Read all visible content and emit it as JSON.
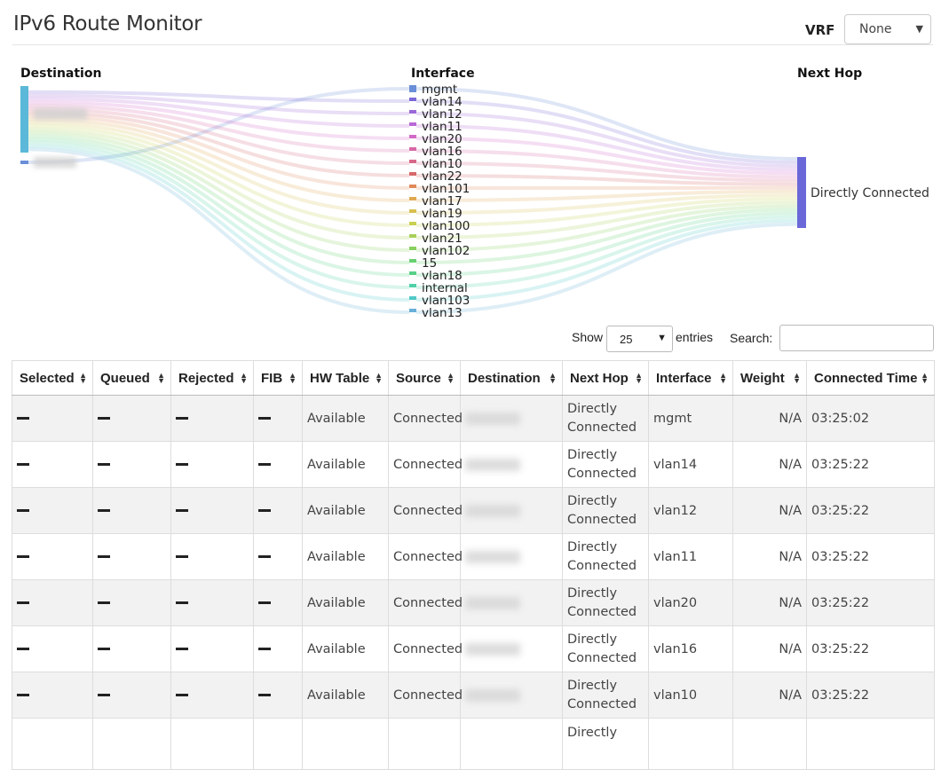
{
  "header": {
    "title": "IPv6 Route Monitor",
    "vrf_label": "VRF",
    "vrf_value": "None"
  },
  "sankey": {
    "headers": {
      "destination": "Destination",
      "interface": "Interface",
      "next_hop": "Next Hop"
    },
    "next_hop_label": "Directly Connected",
    "interfaces": [
      {
        "name": "mgmt",
        "color": "#6a8fd8"
      },
      {
        "name": "vlan14",
        "color": "#7b68d8"
      },
      {
        "name": "vlan12",
        "color": "#9b68d8"
      },
      {
        "name": "vlan11",
        "color": "#b868d8"
      },
      {
        "name": "vlan20",
        "color": "#d268c8"
      },
      {
        "name": "vlan16",
        "color": "#d868a8"
      },
      {
        "name": "vlan10",
        "color": "#d86888"
      },
      {
        "name": "vlan22",
        "color": "#d86868"
      },
      {
        "name": "vlan101",
        "color": "#e08a5a"
      },
      {
        "name": "vlan17",
        "color": "#e0a850"
      },
      {
        "name": "vlan19",
        "color": "#d8c050"
      },
      {
        "name": "vlan100",
        "color": "#c8d050"
      },
      {
        "name": "vlan21",
        "color": "#a8d058"
      },
      {
        "name": "vlan102",
        "color": "#88d060"
      },
      {
        "name": "15",
        "color": "#68d070"
      },
      {
        "name": "vlan18",
        "color": "#58d088"
      },
      {
        "name": "internal",
        "color": "#50d0a8"
      },
      {
        "name": "vlan103",
        "color": "#50c8c8"
      },
      {
        "name": "vlan13",
        "color": "#68b0d8"
      }
    ],
    "colors": {
      "dest_node": "#5bb8d8",
      "dest_node_small": "#6a8fd8",
      "next_hop_node": "#6a68d8"
    }
  },
  "controls": {
    "show_label": "Show",
    "entries_value": "25",
    "entries_label": "entries",
    "search_label": "Search:",
    "search_value": ""
  },
  "table": {
    "columns": [
      "Selected",
      "Queued",
      "Rejected",
      "FIB",
      "HW Table",
      "Source",
      "Destination",
      "Next Hop",
      "Interface",
      "Weight",
      "Connected Time"
    ],
    "rows": [
      {
        "hw": "Available",
        "source": "Connected",
        "next_hop_1": "Directly",
        "next_hop_2": "Connected",
        "interface": "mgmt",
        "weight": "N/A",
        "time": "03:25:02"
      },
      {
        "hw": "Available",
        "source": "Connected",
        "next_hop_1": "Directly",
        "next_hop_2": "Connected",
        "interface": "vlan14",
        "weight": "N/A",
        "time": "03:25:22"
      },
      {
        "hw": "Available",
        "source": "Connected",
        "next_hop_1": "Directly",
        "next_hop_2": "Connected",
        "interface": "vlan12",
        "weight": "N/A",
        "time": "03:25:22"
      },
      {
        "hw": "Available",
        "source": "Connected",
        "next_hop_1": "Directly",
        "next_hop_2": "Connected",
        "interface": "vlan11",
        "weight": "N/A",
        "time": "03:25:22"
      },
      {
        "hw": "Available",
        "source": "Connected",
        "next_hop_1": "Directly",
        "next_hop_2": "Connected",
        "interface": "vlan20",
        "weight": "N/A",
        "time": "03:25:22"
      },
      {
        "hw": "Available",
        "source": "Connected",
        "next_hop_1": "Directly",
        "next_hop_2": "Connected",
        "interface": "vlan16",
        "weight": "N/A",
        "time": "03:25:22"
      },
      {
        "hw": "Available",
        "source": "Connected",
        "next_hop_1": "Directly",
        "next_hop_2": "Connected",
        "interface": "vlan10",
        "weight": "N/A",
        "time": "03:25:22"
      },
      {
        "hw": "",
        "source": "",
        "next_hop_1": "Directly",
        "next_hop_2": "",
        "interface": "",
        "weight": "",
        "time": ""
      }
    ]
  }
}
